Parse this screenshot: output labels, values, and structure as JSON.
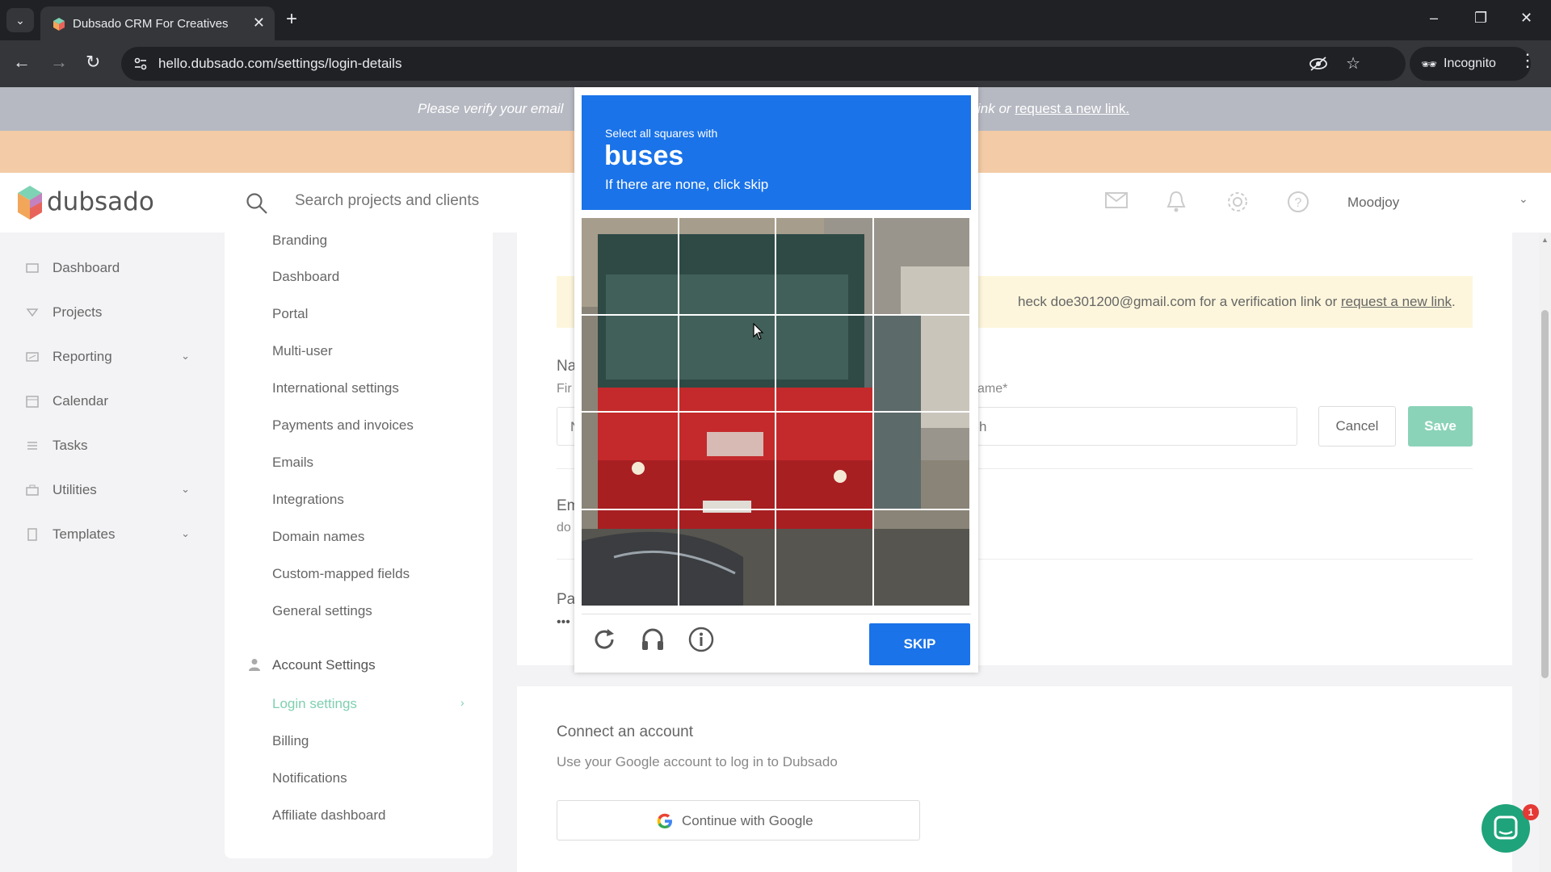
{
  "browser": {
    "tab_title": "Dubsado CRM For Creatives",
    "tab_close": "✕",
    "new_tab": "+",
    "url": "hello.dubsado.com/settings/login-details",
    "incognito_label": "Incognito",
    "window_controls": [
      "–",
      "❐",
      "✕"
    ]
  },
  "banner": {
    "text_left": "Please verify your email",
    "text_right_prefix": "ink or",
    "link": "request a new link."
  },
  "header": {
    "logo_text": "dubsado",
    "search_placeholder": "Search projects and clients",
    "user_name": "Moodjoy",
    "icons": [
      "mail-icon",
      "bell-icon",
      "gear-icon",
      "help-icon"
    ]
  },
  "leftnav": {
    "items": [
      {
        "label": "Dashboard",
        "icon": "dashboard-icon",
        "has_chevron": false
      },
      {
        "label": "Projects",
        "icon": "projects-icon",
        "has_chevron": false
      },
      {
        "label": "Reporting",
        "icon": "reporting-icon",
        "has_chevron": true
      },
      {
        "label": "Calendar",
        "icon": "calendar-icon",
        "has_chevron": false
      },
      {
        "label": "Tasks",
        "icon": "tasks-icon",
        "has_chevron": false
      },
      {
        "label": "Utilities",
        "icon": "utilities-icon",
        "has_chevron": true
      },
      {
        "label": "Templates",
        "icon": "templates-icon",
        "has_chevron": true
      }
    ]
  },
  "settings_menu": {
    "items": [
      "Branding",
      "Dashboard",
      "Portal",
      "Multi-user",
      "International settings",
      "Payments and invoices",
      "Emails",
      "Integrations",
      "Domain names",
      "Custom-mapped fields",
      "General settings"
    ],
    "account_heading": "Account Settings",
    "account_items": [
      "Login settings",
      "Billing",
      "Notifications",
      "Affiliate dashboard"
    ],
    "active_item": "Login settings"
  },
  "main": {
    "notice_text": "heck doe301200@gmail.com for a verification link or",
    "notice_link": "request a new link",
    "notice_end": ".",
    "name_section": "Na",
    "first_name_label": "Fir",
    "first_name_value": "N",
    "last_name_label": "ame*",
    "last_name_value": "h",
    "cancel_label": "Cancel",
    "save_label": "Save",
    "email_section": "Em",
    "email_value": "do",
    "password_section": "Pa",
    "password_value": "•••"
  },
  "connect": {
    "title": "Connect an account",
    "subtitle": "Use your Google account to log in to Dubsado",
    "google_label": "Continue with Google"
  },
  "chat": {
    "badge": "1"
  },
  "captcha": {
    "instruction": "Select all squares with",
    "keyword": "buses",
    "hint": "If there are none, click skip",
    "skip_label": "SKIP",
    "grid_size": 4,
    "icons": [
      "reload-icon",
      "audio-icon",
      "info-icon"
    ]
  },
  "colors": {
    "accent_green": "#7fcfb0",
    "captcha_blue": "#1a73e8",
    "banner_grey": "#b6b9c2",
    "banner_orange": "#f3cba6"
  }
}
